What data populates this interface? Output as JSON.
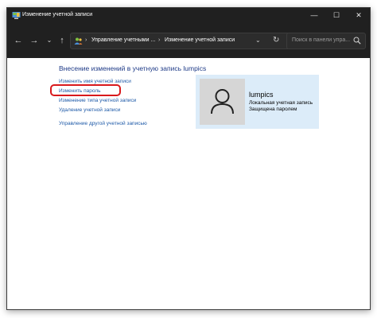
{
  "window": {
    "title": "Изменение учетной записи",
    "controls": {
      "minimize": "—",
      "maximize": "☐",
      "close": "✕"
    }
  },
  "navbar": {
    "back": "←",
    "forward": "→",
    "recent": "⌄",
    "up": "↑",
    "breadcrumb": [
      "Управление учетными ...",
      "Изменение учетной записи"
    ],
    "separator": "›",
    "dropdown": "⌄",
    "refresh": "↻",
    "search_placeholder": "Поиск в панели упра..."
  },
  "main": {
    "heading": "Внесение изменений в учетную запись lumpics",
    "links": [
      "Изменить имя учетной записи",
      "Изменить пароль",
      "Изменение типа учетной записи",
      "Удаление учетной записи",
      "Управление другой учетной записью"
    ]
  },
  "account": {
    "name": "lumpics",
    "type": "Локальная учетная запись",
    "status": "Защищена паролем"
  },
  "colors": {
    "titlebar": "#202020",
    "link": "#1e5aa8",
    "heading": "#1e3a87",
    "card": "#dcecf9",
    "highlight": "#d9191c"
  },
  "icons": [
    "control-panel-icon",
    "user-avatar-icon",
    "search-icon",
    "refresh-icon"
  ]
}
